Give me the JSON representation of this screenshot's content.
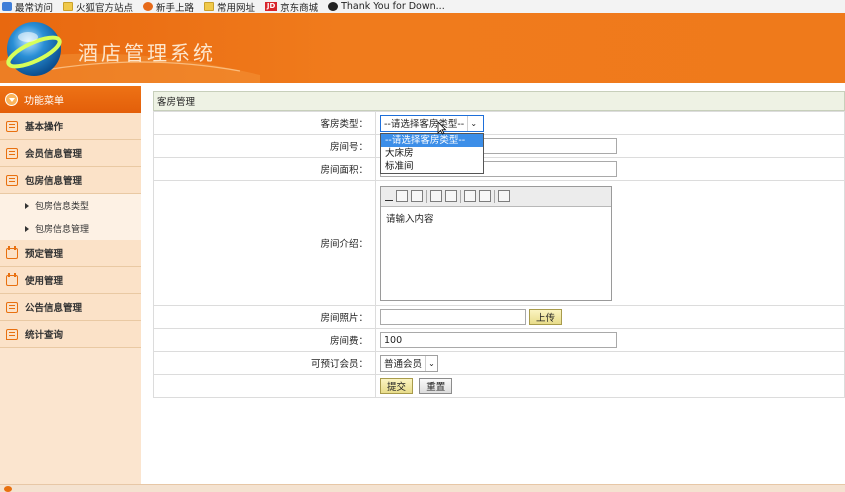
{
  "bookmarks": [
    {
      "label": "最常访问",
      "icon": "star-icon"
    },
    {
      "label": "火狐官方站点",
      "icon": "folder-icon"
    },
    {
      "label": "新手上路",
      "icon": "firefox-icon"
    },
    {
      "label": "常用网址",
      "icon": "folder-icon"
    },
    {
      "label": "京东商城",
      "icon": "jd-icon"
    },
    {
      "label": "Thank You for Down...",
      "icon": "globe-icon"
    }
  ],
  "jd_badge": "JD",
  "header": {
    "title": "酒店管理系统"
  },
  "sidebar": {
    "head": "功能菜单",
    "items": [
      {
        "label": "基本操作"
      },
      {
        "label": "会员信息管理"
      },
      {
        "label": "包房信息管理"
      },
      {
        "label": "预定管理"
      },
      {
        "label": "使用管理"
      },
      {
        "label": "公告信息管理"
      },
      {
        "label": "统计查询"
      }
    ],
    "subitems": [
      {
        "label": "包房信息类型"
      },
      {
        "label": "包房信息管理"
      }
    ]
  },
  "main": {
    "title": "客房管理",
    "labels": {
      "room_type": "客房类型：",
      "room_no": "房间号：",
      "area": "房间面积：",
      "intro": "房间介绍：",
      "photo": "房间照片：",
      "price": "房间费：",
      "member": "可预订会员："
    },
    "room_type_select": "--请选择客房类型--",
    "room_type_options": [
      "--请选择客房类型--",
      "大床房",
      "标准间"
    ],
    "room_no_value": "",
    "area_value": "",
    "editor_placeholder": "请输入内容",
    "photo_value": "",
    "upload_label": "上传",
    "price_value": "100",
    "member_select": "普通会员",
    "submit_label": "提交",
    "reset_label": "重置"
  },
  "colors": {
    "accent": "#ee7215",
    "sidebar_bg": "#fbe2c8",
    "select_focus": "#1e6fd9",
    "option_highlight": "#3c8ee8"
  }
}
